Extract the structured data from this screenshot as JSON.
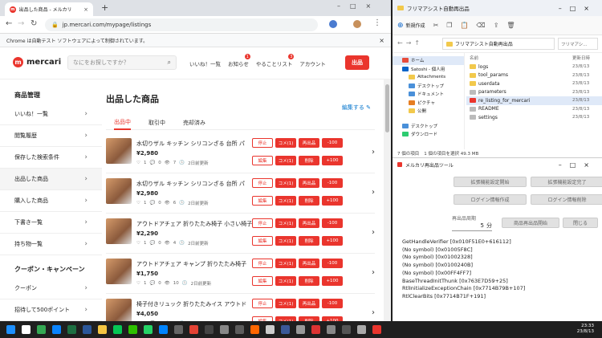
{
  "chrome": {
    "tab_title": "出品した商品 - メルカリ",
    "new_tab": "+",
    "url": "jp.mercari.com/mypage/listings",
    "infobar": "Chrome は自動テスト ソフトウェアによって制御されています。",
    "infobar_close": "×"
  },
  "mercari": {
    "logo": "mercari",
    "search_placeholder": "なにをお探しですか？",
    "nav": [
      {
        "label": "いいね！一覧",
        "badge": ""
      },
      {
        "label": "お知らせ",
        "badge": "1"
      },
      {
        "label": "やることリスト",
        "badge": "3"
      },
      {
        "label": "アカウント",
        "badge": ""
      }
    ],
    "list_button": "出品",
    "sidebar": {
      "heading1": "商品管理",
      "items": [
        "いいね！一覧",
        "閲覧履歴",
        "保存した検索条件",
        "出品した商品",
        "購入した商品",
        "下書き一覧",
        "持ち物一覧"
      ],
      "heading2": "クーポン・キャンペーン",
      "items2": [
        "クーポン",
        "招待して500ポイント"
      ]
    },
    "page_title": "出品した商品",
    "edit_link": "編集する",
    "tabs": [
      "出品中",
      "取引中",
      "売却済み"
    ],
    "items": [
      {
        "title": "水切りザル キッチン シリコンざる 台所 パ",
        "price": "¥2,980",
        "likes": "1",
        "comments": "0",
        "views": "7",
        "age": "2日前更新"
      },
      {
        "title": "水切りザル キッチン シリコンざる 台所 パ",
        "price": "¥2,980",
        "likes": "1",
        "comments": "0",
        "views": "6",
        "age": "2日前更新"
      },
      {
        "title": "アウトドアチェア 折りたたみ椅子 小さい椅子",
        "price": "¥2,290",
        "likes": "1",
        "comments": "0",
        "views": "4",
        "age": "2日前更新"
      },
      {
        "title": "アウトドアチェア キャンプ 折りたたみ椅子",
        "price": "¥1,750",
        "likes": "1",
        "comments": "0",
        "views": "10",
        "age": "2日前更新"
      },
      {
        "title": "椅子付きリュック 折りたたみイス アウトド",
        "price": "¥4,050",
        "likes": "1",
        "comments": "0",
        "views": "9",
        "age": "2日前更新"
      }
    ],
    "buttons_row1": [
      "停止",
      "コメ(1)",
      "再出品",
      "-100"
    ],
    "buttons_row2": [
      "編集",
      "コメ(1)",
      "削除",
      "+100"
    ]
  },
  "explorer": {
    "title": "フリマアシスト自動再出品",
    "new_button": "新規作成",
    "path": "フリマアシスト自動再出品",
    "search": "フリマアシ...",
    "nav": [
      {
        "label": "ホーム",
        "sub": false,
        "sel": true
      },
      {
        "label": "Satoshi - 個人用",
        "sub": false,
        "sel": false
      },
      {
        "label": "Attachments",
        "sub": true,
        "sel": false
      },
      {
        "label": "デスクトップ",
        "sub": true,
        "sel": false
      },
      {
        "label": "ドキュメント",
        "sub": true,
        "sel": false
      },
      {
        "label": "ピクチャ",
        "sub": true,
        "sel": false
      },
      {
        "label": "公開",
        "sub": true,
        "sel": false
      },
      {
        "label": "デスクトップ",
        "sub": false,
        "sel": false
      },
      {
        "label": "ダウンロード",
        "sub": false,
        "sel": false
      }
    ],
    "col_name": "名前",
    "col_date": "更新日時",
    "files": [
      {
        "name": "logs",
        "date": "23/8/13",
        "icon": "folder"
      },
      {
        "name": "tool_params",
        "date": "23/8/13",
        "icon": "folder"
      },
      {
        "name": "userdata",
        "date": "23/8/13",
        "icon": "folder"
      },
      {
        "name": "parameters",
        "date": "23/8/13",
        "icon": "file"
      },
      {
        "name": "re_listing_for_mercari",
        "date": "23/8/13",
        "icon": "app"
      },
      {
        "name": "README",
        "date": "23/8/13",
        "icon": "file"
      },
      {
        "name": "settings",
        "date": "23/8/13",
        "icon": "file"
      }
    ],
    "status_count": "7 個の項目",
    "status_sel": "1 個の項目を選択  49.3 MB"
  },
  "tool": {
    "title": "メルカリ再出品ツール",
    "btn_row1": [
      "拡張機能設定開始",
      "拡張機能設定完了"
    ],
    "btn_row2": [
      "ログイン情報作成",
      "ログイン情報削除"
    ],
    "interval_label": "再出品周期",
    "interval_value": "5",
    "interval_unit": "分",
    "start_button": "商品再出品開始",
    "close_button": "閉じる",
    "log": [
      "GetHandleVerifier [0x010F51E0+616112]",
      "(No symbol) [0x01005F8C]",
      "(No symbol) [0x01002328]",
      "(No symbol) [0x0100240B]",
      "(No symbol) [0x00FF4FF7]",
      "BaseThreadInitThunk [0x763E7D59+25]",
      "RtlInitializeExceptionChain [0x7714B79B+107]",
      "RtlClearBits [0x7714B71F+191]"
    ]
  },
  "taskbar": {
    "time": "23:33",
    "date": "23/8/13",
    "icons": [
      "start-icon",
      "search-icon",
      "chrome-icon",
      "edge-icon",
      "excel-icon",
      "word-icon",
      "explorer-icon",
      "line-icon",
      "wechat-icon",
      "whatsapp-icon",
      "messenger-icon",
      "settings-icon",
      "media-icon",
      "app-icon",
      "app-icon",
      "app-icon",
      "app-icon",
      "app-icon",
      "app-icon",
      "app-icon",
      "app-icon",
      "app-icon",
      "app-icon",
      "app-icon",
      "tool-icon"
    ],
    "icon_colors": [
      "#1e90ff",
      "#ffffff",
      "#34a853",
      "#0a84ff",
      "#1d6f42",
      "#2b579a",
      "#f4c542",
      "#06c755",
      "#2dc100",
      "#25d366",
      "#0084ff",
      "#666666",
      "#e34234",
      "#444444",
      "#888888",
      "#5c5c5c",
      "#ff6600",
      "#cccccc",
      "#3b5998",
      "#999999",
      "#d33",
      "#888",
      "#555",
      "#aaa",
      "#ea352d"
    ]
  }
}
